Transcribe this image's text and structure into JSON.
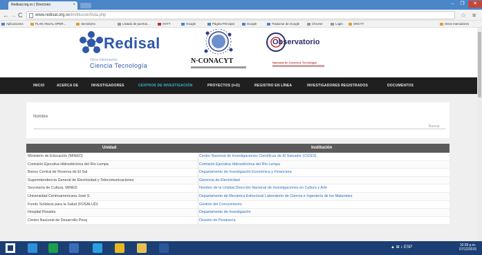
{
  "browser": {
    "tab_title": "Redisal.org.sv | Directorio",
    "tab_close": "×",
    "url_host": "www.redisal.org.sv",
    "url_path": "/institucion/lista.php",
    "controls": {
      "min": "–",
      "max": "❐",
      "close": "✕"
    },
    "nav": {
      "back": "←",
      "forward": "→",
      "reload": "C"
    },
    "star": "☆",
    "menu": "≡"
  },
  "bookmarks": [
    {
      "label": "Aplicaciones",
      "color": "#4a86c8"
    },
    {
      "label": "PLAN ANUAL OPER...",
      "color": "#d8a23a"
    },
    {
      "label": "Servidores",
      "color": "#d8a23a"
    },
    {
      "label": "Listado de puertos...",
      "color": "#999999"
    },
    {
      "label": "OVTT",
      "color": "#c03030"
    },
    {
      "label": "Google",
      "color": "#4a86c8"
    },
    {
      "label": "Página Principal",
      "color": "#4a86c8"
    },
    {
      "label": "Google",
      "color": "#4a86c8"
    },
    {
      "label": "Traductor de Google",
      "color": "#4a86c8"
    },
    {
      "label": "Chrome",
      "color": "#999999"
    },
    {
      "label": "Login",
      "color": "#999999"
    },
    {
      "label": "ONCYT",
      "color": "#d8a23a"
    },
    {
      "label": "Otros marcadores",
      "color": "#d8a23a"
    }
  ],
  "header": {
    "redisal": {
      "name": "Redisal",
      "sub1": "Otros Información",
      "sub2": "Ciencia Tecnología"
    },
    "conacyt": {
      "name": "N·CONACYT"
    },
    "observatorio": {
      "name": "Observatorio",
      "tag": "Nacional de Ciencia & Tecnología"
    }
  },
  "nav": [
    {
      "label": "INICIO",
      "active": false
    },
    {
      "label": "ACERCA DE",
      "active": false
    },
    {
      "label": "INVESTIGADORES",
      "active": false
    },
    {
      "label": "CENTROS DE INVESTIGACIÓN",
      "active": true
    },
    {
      "label": "PROYECTOS (I+D)",
      "active": false
    },
    {
      "label": "REGISTRO EN LÍNEA",
      "active": false
    },
    {
      "label": "INVESTIGADORES REGISTRADOS",
      "active": false
    },
    {
      "label": "DOCUMENTOS",
      "active": false
    }
  ],
  "search": {
    "label": "Nombre",
    "button": "Buscar"
  },
  "table": {
    "headers": [
      "Unidad",
      "Institución"
    ],
    "rows": [
      [
        "Ministerio de Educación (MINED)",
        "Centro Nacional de Investigaciones Científicas de El Salvador (CICES)"
      ],
      [
        "Comisión Ejecutiva Hidroeléctrica del Río Lempa",
        "Comisión Ejecutiva Hidroeléctrica del Río Lempa"
      ],
      [
        "Banco Central de Reserva de El Sal",
        "Departamento de Investigación Económica y Financiera"
      ],
      [
        "Superintendencia General de Electricidad y Telecomunicaciones",
        "Gerencia de Electricidad"
      ],
      [
        "Secretaría de Cultura, MINED",
        "Nombre de la Unidad Dirección Nacional de Investigaciones en Cultura y Arte"
      ],
      [
        "Universidad Centroamericana José S",
        "Departamento de Mecánica Estructural Laboratorio de Ciencia e Ingeniería de los Materiales"
      ],
      [
        "Fondo Solidario para la Salud (FOSALUD)",
        "Gestión del Conocimiento"
      ],
      [
        "Hospital Rosales",
        "Departamento de Investigación"
      ],
      [
        "Centro Nacional de Desarrollo Pesq",
        "División de Pesquería"
      ]
    ]
  },
  "taskbar": {
    "icons": [
      {
        "name": "windows-start-icon",
        "color": "#ffffff"
      },
      {
        "name": "internet-explorer-icon",
        "color": "#2f8fd8"
      },
      {
        "name": "store-icon",
        "color": "#1d9e4a"
      },
      {
        "name": "media-icon",
        "color": "#3a6db8"
      },
      {
        "name": "pen-tool-icon",
        "color": "#2aa0e0"
      },
      {
        "name": "chrome-icon",
        "color": "#e8b820"
      },
      {
        "name": "file-explorer-icon",
        "color": "#e8c050"
      },
      {
        "name": "word-icon",
        "color": "#2b5797"
      }
    ],
    "tray": "▲  ⊞  ♪  ESP",
    "time": "10:28 p.m.",
    "date": "07/12/2015"
  }
}
